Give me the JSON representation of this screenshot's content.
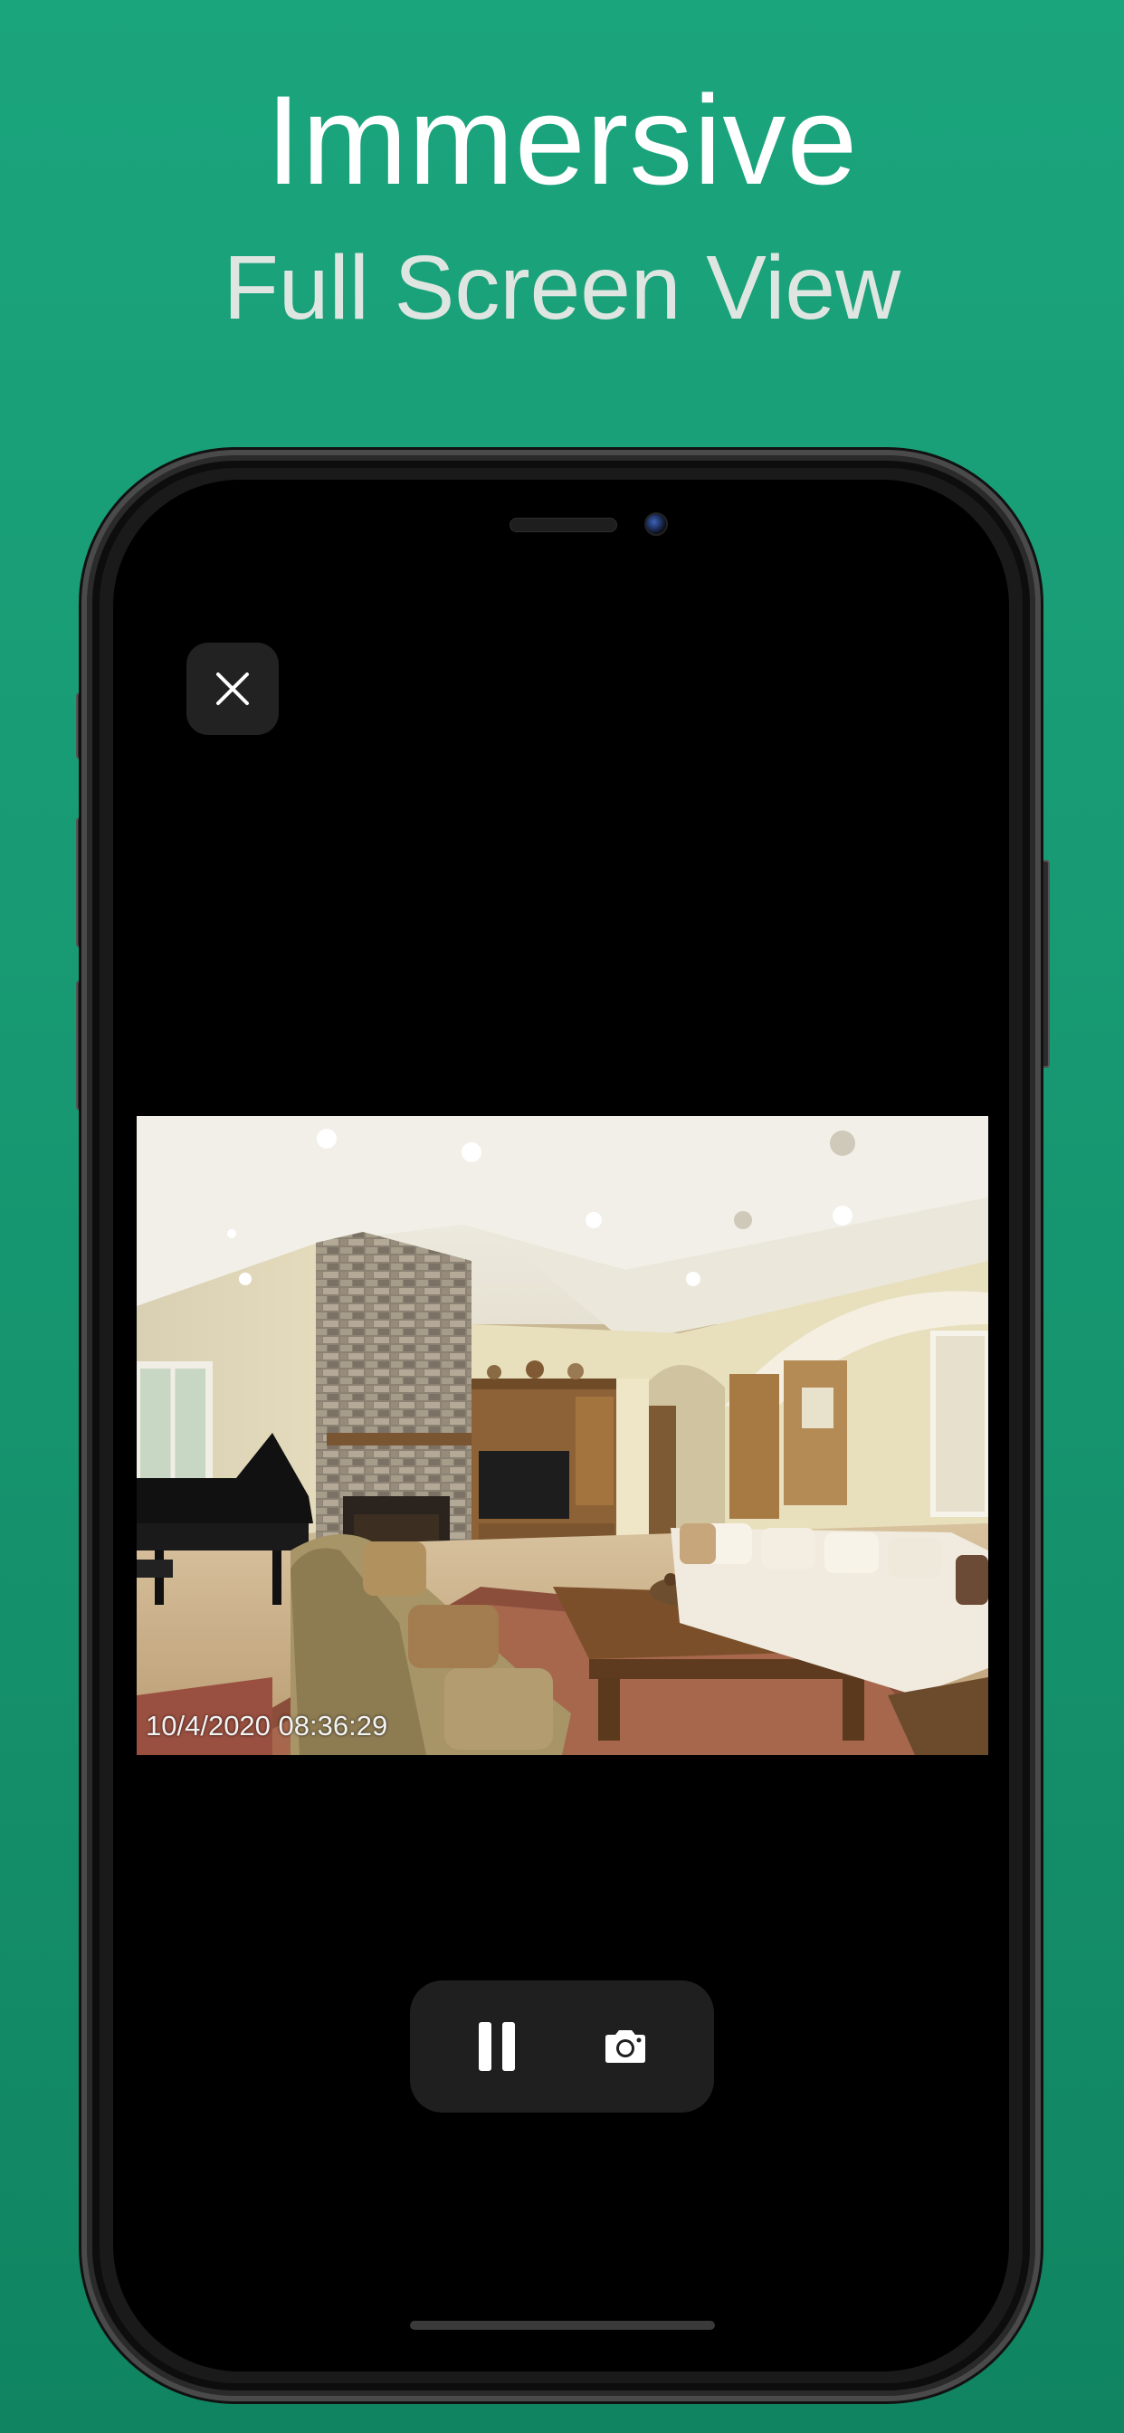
{
  "promo": {
    "headline": "Immersive",
    "subheadline": "Full Screen View"
  },
  "viewer": {
    "close_icon": "close-icon",
    "feed": {
      "scene": "living-room",
      "timestamp": "10/4/2020 08:36:29"
    },
    "controls": {
      "pause_icon": "pause-icon",
      "snapshot_icon": "camera-icon"
    }
  },
  "colors": {
    "background_top": "#1ba57d",
    "background_bottom": "#108460",
    "control_surface": "#1f1f1f",
    "headline": "#ffffff",
    "subheadline": "#dfe6e2"
  }
}
